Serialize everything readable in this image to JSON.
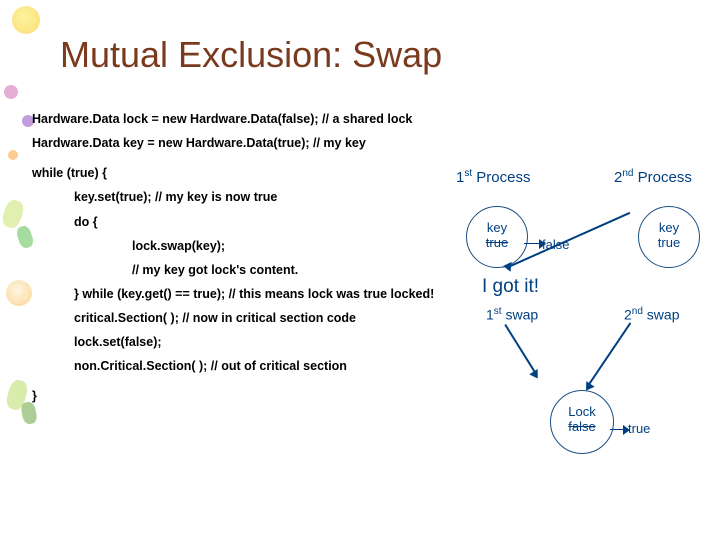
{
  "title": "Mutual Exclusion: Swap",
  "code": {
    "l1": "Hardware.Data lock = new Hardware.Data(false); // a shared lock",
    "l2": "Hardware.Data key = new Hardware.Data(true);  // my key",
    "l3": "while (true) {",
    "l4": "key.set(true); // my key is now true",
    "l5": "do {",
    "l6": "lock.swap(key);",
    "l7": "// my key got lock's content.",
    "l8": "} while (key.get() == true); // this means lock was true locked!",
    "l9": "critical.Section( ); // now in critical section code",
    "l10": "lock.set(false);",
    "l11": "non.Critical.Section( ); // out of critical section",
    "l12": "}"
  },
  "diagram": {
    "p1_prefix": "1",
    "p1_sup": "st",
    "p1_suffix": " Process",
    "p2_prefix": "2",
    "p2_sup": "nd",
    "p2_suffix": " Process",
    "key_label": "key",
    "kc1_value": "true",
    "false_label": "false",
    "kc2_value": "true",
    "got_it": "I got it!",
    "swap1_prefix": "1",
    "swap1_sup": "st",
    "swap1_suffix": " swap",
    "swap2_prefix": "2",
    "swap2_sup": "nd",
    "swap2_suffix": " swap",
    "lock_label": "Lock",
    "lock_value": "false",
    "true_label": "true"
  }
}
